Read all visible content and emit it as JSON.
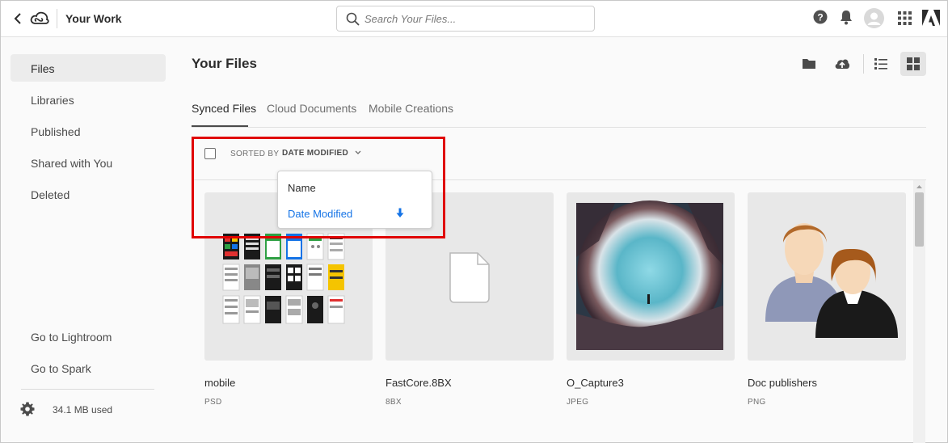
{
  "header": {
    "title": "Your Work",
    "search_placeholder": "Search Your Files...",
    "icons": [
      "back-icon",
      "creative-cloud-logo",
      "search-icon",
      "help-icon",
      "bell-icon",
      "avatar-icon",
      "apps-grid-icon",
      "adobe-logo"
    ]
  },
  "sidebar": {
    "items": [
      {
        "label": "Files",
        "active": true
      },
      {
        "label": "Libraries"
      },
      {
        "label": "Published"
      },
      {
        "label": "Shared with You"
      },
      {
        "label": "Deleted"
      }
    ],
    "links": [
      {
        "label": "Go to Lightroom"
      },
      {
        "label": "Go to Spark"
      }
    ],
    "storage": "34.1 MB used"
  },
  "main": {
    "title": "Your Files",
    "tabs": [
      {
        "label": "Synced Files",
        "active": true
      },
      {
        "label": "Cloud Documents"
      },
      {
        "label": "Mobile Creations"
      }
    ],
    "sort": {
      "prefix": "SORTED BY",
      "value": "DATE MODIFIED",
      "options": [
        {
          "label": "Name"
        },
        {
          "label": "Date Modified",
          "selected": true
        }
      ]
    },
    "files": [
      {
        "name": "mobile",
        "type": "PSD"
      },
      {
        "name": "FastCore.8BX",
        "type": "8BX"
      },
      {
        "name": "O_Capture3",
        "type": "JPEG"
      },
      {
        "name": "Doc publishers",
        "type": "PNG"
      }
    ]
  },
  "colors": {
    "accent": "#1473e6",
    "highlight": "#e00000"
  }
}
